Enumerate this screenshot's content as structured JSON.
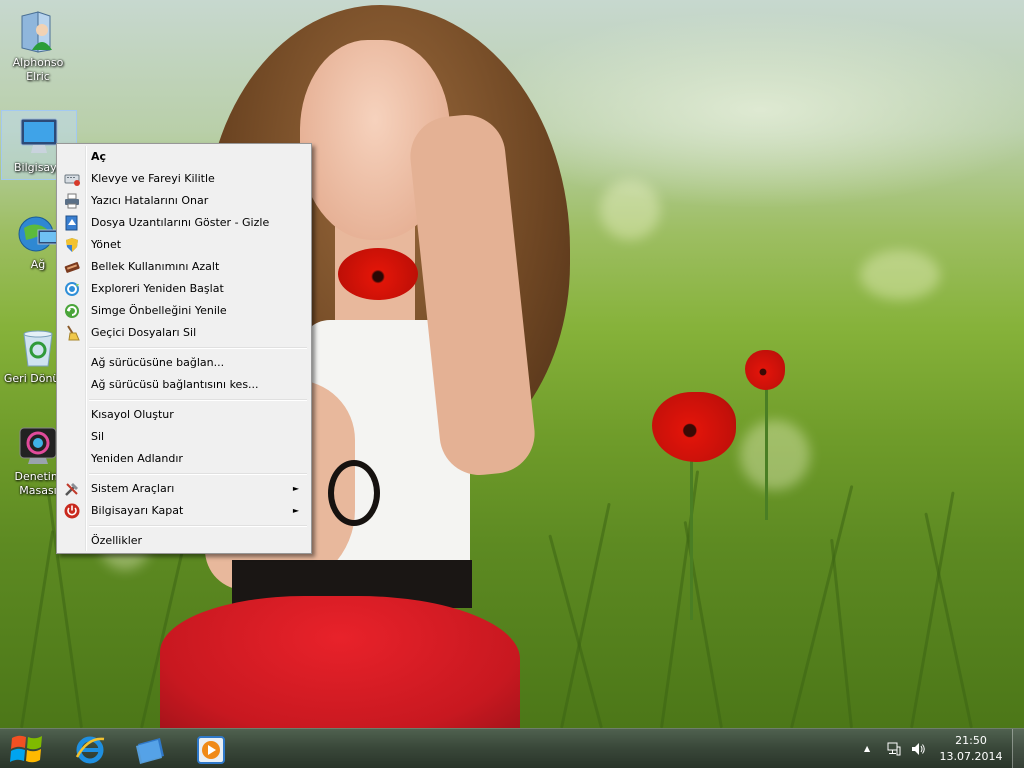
{
  "desktop_icons": [
    {
      "label": "Alphonso Elric",
      "icon": "user-folder-icon"
    },
    {
      "label": "Bilgisay",
      "icon": "computer-icon"
    },
    {
      "label": "Ağ",
      "icon": "network-globe-icon"
    },
    {
      "label": "Geri Dönüşü",
      "icon": "recycle-bin-icon"
    },
    {
      "label": "Denetim Masası",
      "icon": "control-panel-icon"
    }
  ],
  "context_menu": {
    "items": [
      {
        "label": "Aç",
        "icon": ""
      },
      {
        "label": "Klevye ve Fareyi Kilitle",
        "icon": "keyboard-lock-icon"
      },
      {
        "label": "Yazıcı Hatalarını Onar",
        "icon": "printer-icon"
      },
      {
        "label": "Dosya Uzantılarını Göster - Gizle",
        "icon": "file-extension-icon"
      },
      {
        "label": "Yönet",
        "icon": "shield-icon"
      },
      {
        "label": "Bellek Kullanımını Azalt",
        "icon": "memory-chip-icon"
      },
      {
        "label": "Exploreri Yeniden Başlat",
        "icon": "explorer-restart-icon"
      },
      {
        "label": "Simge Önbelleğini Yenile",
        "icon": "refresh-icon"
      },
      {
        "label": "Geçici Dosyaları Sil",
        "icon": "broom-icon"
      },
      {
        "label": "Ağ sürücüsüne bağlan...",
        "icon": ""
      },
      {
        "label": "Ağ sürücüsü bağlantısını kes...",
        "icon": ""
      },
      {
        "label": "Kısayol Oluştur",
        "icon": ""
      },
      {
        "label": "Sil",
        "icon": ""
      },
      {
        "label": "Yeniden Adlandır",
        "icon": ""
      },
      {
        "label": "Sistem Araçları",
        "icon": "tools-icon",
        "submenu": true
      },
      {
        "label": "Bilgisayarı Kapat",
        "icon": "power-icon",
        "submenu": true
      },
      {
        "label": "Özellikler",
        "icon": ""
      }
    ]
  },
  "taskbar": {
    "pinned": [
      {
        "name": "start",
        "icon": "windows-logo-icon"
      },
      {
        "name": "internet-explorer",
        "icon": "internet-explorer-icon"
      },
      {
        "name": "file-explorer",
        "icon": "libraries-icon"
      },
      {
        "name": "media-player",
        "icon": "media-player-icon"
      }
    ],
    "clock": {
      "time": "21:50",
      "date": "13.07.2014"
    },
    "tray": {
      "show_hidden": "▲"
    }
  }
}
